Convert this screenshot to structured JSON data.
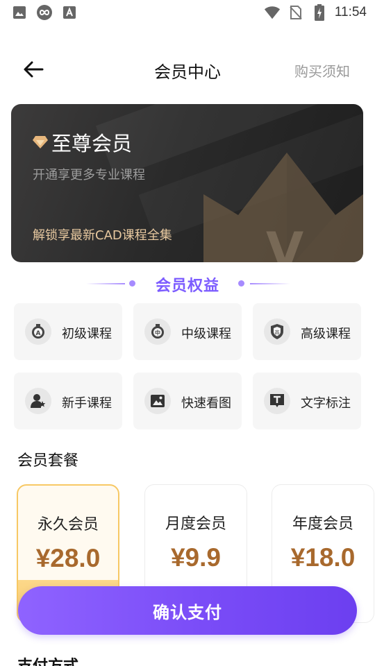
{
  "status_bar": {
    "time": "11:54",
    "left_icons": [
      "gallery-icon",
      "app-logo-icon",
      "font-app-icon"
    ],
    "right_icons": [
      "wifi-icon",
      "no-sim-icon",
      "battery-charging-icon"
    ]
  },
  "header": {
    "title": "会员中心",
    "right_link": "购买须知"
  },
  "banner": {
    "title": "至尊会员",
    "subtitle": "开通享更多专业课程",
    "unlock_text": "解锁享最新CAD课程全集"
  },
  "benefits": {
    "heading": "会员权益",
    "items": [
      {
        "label": "初级课程",
        "icon": "beginner-medal-icon"
      },
      {
        "label": "中级课程",
        "icon": "intermediate-medal-icon"
      },
      {
        "label": "高级课程",
        "icon": "advanced-shield-icon"
      },
      {
        "label": "新手课程",
        "icon": "newbie-user-icon"
      },
      {
        "label": "快速看图",
        "icon": "image-view-icon"
      },
      {
        "label": "文字标注",
        "icon": "text-annotation-icon"
      }
    ]
  },
  "packages": {
    "heading": "会员套餐",
    "items": [
      {
        "name": "永久会员",
        "price": "¥28.0",
        "selected": true
      },
      {
        "name": "月度会员",
        "price": "¥9.9",
        "selected": false
      },
      {
        "name": "年度会员",
        "price": "¥18.0",
        "selected": false
      }
    ]
  },
  "pay_button": "确认支付",
  "payment_method_heading": "支付方式",
  "colors": {
    "accent_purple": "#7c5cff",
    "price_brown": "#a8692d",
    "selected_border": "#f7c864",
    "banner_gold": "#e8c9a0"
  }
}
